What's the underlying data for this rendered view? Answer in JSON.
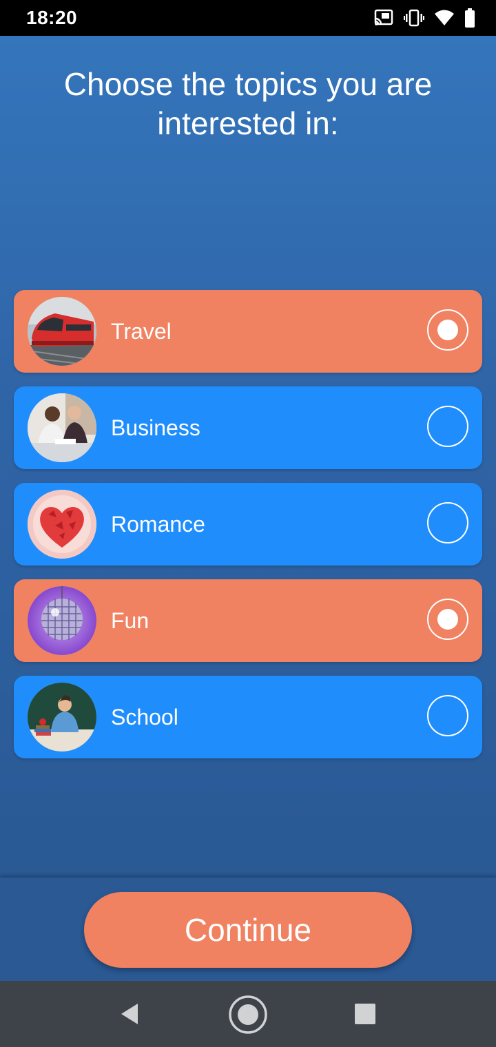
{
  "status_bar": {
    "time": "18:20",
    "icons": [
      "cast-icon",
      "vibrate-icon",
      "wifi-icon",
      "battery-icon"
    ]
  },
  "title": "Choose the topics you are interested in:",
  "topics": [
    {
      "label": "Travel",
      "selected": true,
      "thumbnail": "train-photo"
    },
    {
      "label": "Business",
      "selected": false,
      "thumbnail": "business-meeting-photo"
    },
    {
      "label": "Romance",
      "selected": false,
      "thumbnail": "heart-photo"
    },
    {
      "label": "Fun",
      "selected": true,
      "thumbnail": "disco-ball-photo"
    },
    {
      "label": "School",
      "selected": false,
      "thumbnail": "teacher-photo"
    }
  ],
  "continue_label": "Continue",
  "nav": {
    "icons": [
      "back-icon",
      "home-icon",
      "recents-icon"
    ]
  },
  "colors": {
    "selected_card": "#f08262",
    "unselected_card": "#1f8efc",
    "background": "#2f64a6",
    "button": "#f08262"
  }
}
